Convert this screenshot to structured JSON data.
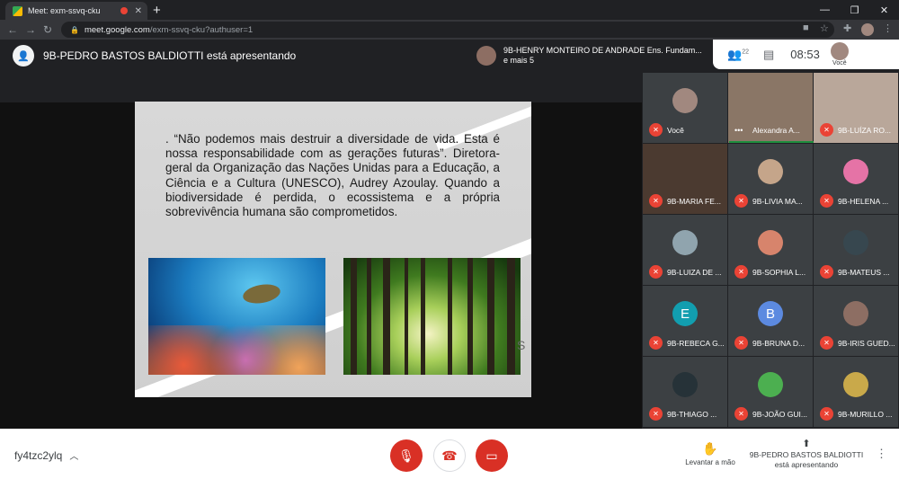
{
  "browser": {
    "tab_title": "Meet: exm-ssvq-cku",
    "tab_close": "✕",
    "new_tab": "+",
    "url_host": "meet.google.com",
    "url_path": "/exm-ssvq-cku?authuser=1",
    "window_controls": [
      "—",
      "❐",
      "✕"
    ]
  },
  "meet": {
    "presenter_banner": "9B-PEDRO BASTOS BALDIOTTI está apresentando",
    "active_speaker": {
      "name": "9B-HENRY MONTEIRO DE ANDRADE Ens. Fundam...",
      "extra": "e mais 5"
    },
    "participants_count": "22",
    "clock": "08:53",
    "self_label": "Você",
    "slide": {
      "text": ". “Não podemos mais destruir a diversidade de vida. Esta é nossa responsabilidade com as gerações futuras”. Diretora-geral da Organização das Nações Unidas para a Educação, a Ciência e a Cultura (UNESCO), Audrey Azoulay. Quando a biodiversidade é perdida, o ecossistema e a própria sobrevivência humana são comprometidos.",
      "edge_mark": "S"
    },
    "tiles": [
      {
        "name": "Você",
        "type": "avatar",
        "color": "#a1887f"
      },
      {
        "name": "Alexandra A...",
        "type": "video",
        "color": "#8a7666",
        "speaking": true
      },
      {
        "name": "9B-LUÍZA RO...",
        "type": "video",
        "color": "#b9a79a"
      },
      {
        "name": "9B-MARIA FE...",
        "type": "video",
        "color": "#4b3a30"
      },
      {
        "name": "9B-LIVIA MA...",
        "type": "avatar",
        "color": "#c5a58a"
      },
      {
        "name": "9B-HELENA ...",
        "type": "avatar",
        "color": "#e573a6"
      },
      {
        "name": "9B-LUIZA DE ...",
        "type": "avatar",
        "color": "#90a4ae"
      },
      {
        "name": "9B-SOPHIA L...",
        "type": "avatar",
        "color": "#d7846c"
      },
      {
        "name": "9B-MATEUS ...",
        "type": "avatar",
        "color": "#37474f"
      },
      {
        "name": "9B-REBECA G...",
        "type": "letter",
        "letter": "E",
        "color": "#129eaf"
      },
      {
        "name": "9B-BRUNA D...",
        "type": "letter",
        "letter": "B",
        "color": "#5c8ae0"
      },
      {
        "name": "9B-IRIS GUED...",
        "type": "avatar",
        "color": "#8d6e63"
      },
      {
        "name": "9B-THIAGO ...",
        "type": "avatar",
        "color": "#263238"
      },
      {
        "name": "9B-JOÃO GUI...",
        "type": "avatar",
        "color": "#4caf50"
      },
      {
        "name": "9B-MURILLO ...",
        "type": "avatar",
        "color": "#c9a94a"
      }
    ],
    "bottom": {
      "meeting_code": "fy4tzc2ylq",
      "raise_hand": "Levantar a mão",
      "presenting_name": "9B-PEDRO BASTOS BALDIOTTI",
      "presenting_status": "está apresentando"
    }
  },
  "colors": {
    "accent_red": "#d93025",
    "speaking_green": "#1e8e3e"
  }
}
